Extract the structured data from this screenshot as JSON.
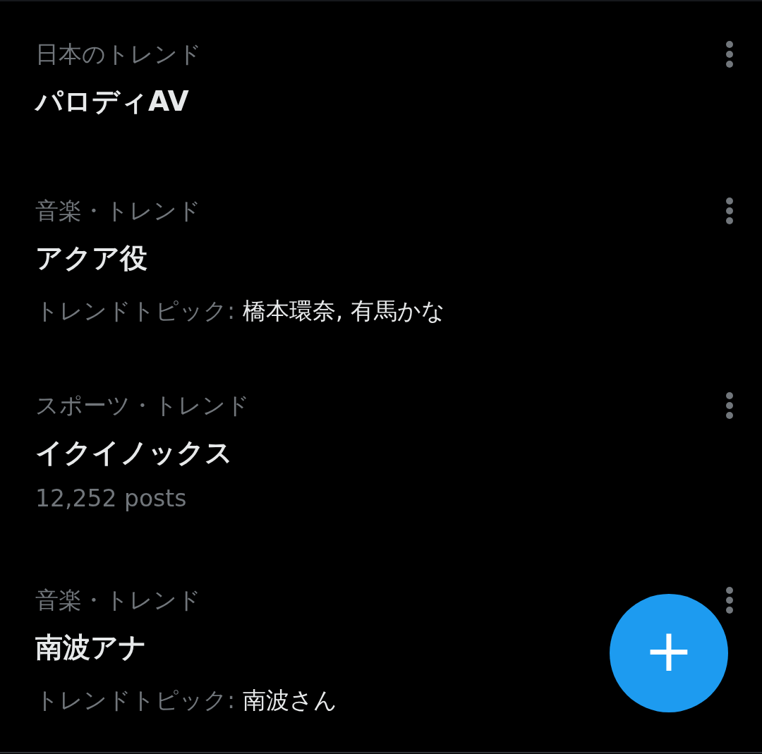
{
  "trends": [
    {
      "category": "日本のトレンド",
      "title": "パロディAV"
    },
    {
      "category": "音楽・トレンド",
      "title": "アクア役",
      "topic_label": "トレンドトピック:",
      "topics": "橋本環奈, 有馬かな"
    },
    {
      "category": "スポーツ・トレンド",
      "title": "イクイノックス",
      "post_count": "12,252 posts"
    },
    {
      "category": "音楽・トレンド",
      "title": "南波アナ",
      "topic_label": "トレンドトピック:",
      "topics": "南波さん"
    }
  ],
  "compose_button": {
    "label": "+"
  }
}
